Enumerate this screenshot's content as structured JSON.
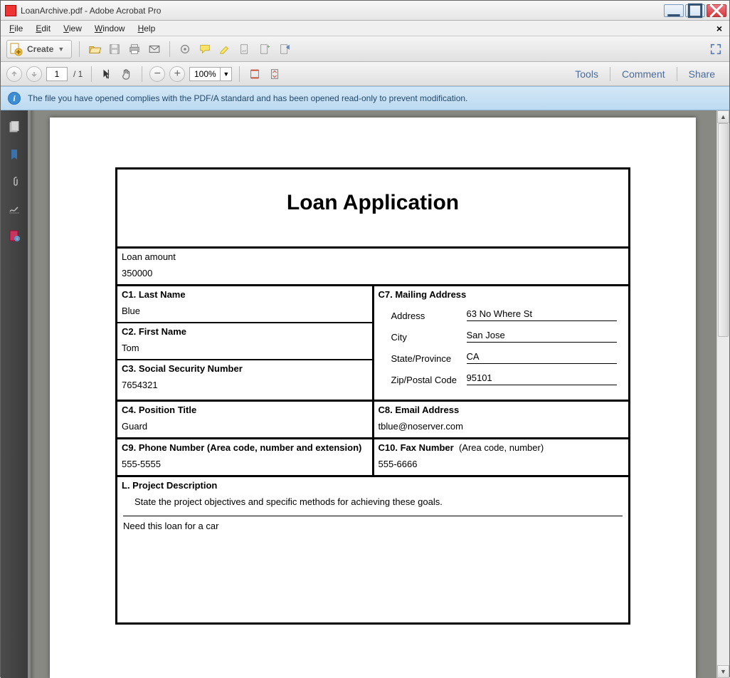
{
  "window": {
    "title": "LoanArchive.pdf - Adobe Acrobat Pro"
  },
  "menus": {
    "file": "File",
    "edit": "Edit",
    "view": "View",
    "window": "Window",
    "help": "Help"
  },
  "toolbar": {
    "create": "Create"
  },
  "nav": {
    "current_page": "1",
    "page_count": "/ 1",
    "zoom": "100%"
  },
  "panels": {
    "tools": "Tools",
    "comment": "Comment",
    "share": "Share"
  },
  "infobar": {
    "message": "The file you have opened complies with the PDF/A standard and has been opened read-only to prevent modification."
  },
  "form": {
    "title": "Loan Application",
    "loan_amount_lbl": "Loan amount",
    "loan_amount": "350000",
    "c1_lbl": "C1. Last Name",
    "c1_val": "Blue",
    "c2_lbl": "C2. First Name",
    "c2_val": "Tom",
    "c3_lbl": "C3. Social Security Number",
    "c3_val": "7654321",
    "c4_lbl": "C4. Position Title",
    "c4_val": "Guard",
    "c7_lbl": "C7. Mailing Address",
    "addr_label": "Address",
    "addr_val": "63 No Where St",
    "city_label": "City",
    "city_val": "San Jose",
    "state_label": "State/Province",
    "state_val": "CA",
    "zip_label": "Zip/Postal Code",
    "zip_val": "95101",
    "c8_lbl": "C8. Email Address",
    "c8_val": "tblue@noserver.com",
    "c9_lbl": "C9. Phone Number (Area code, number and extension)",
    "c9_val": "555-5555",
    "c10_lbl": "C10. Fax Number",
    "c10_hint": "(Area code, number)",
    "c10_val": "555-6666",
    "L_lbl": "L. Project Description",
    "L_instr": "State the project objectives and specific methods for achieving these goals.",
    "L_val": "Need this loan for a car"
  }
}
